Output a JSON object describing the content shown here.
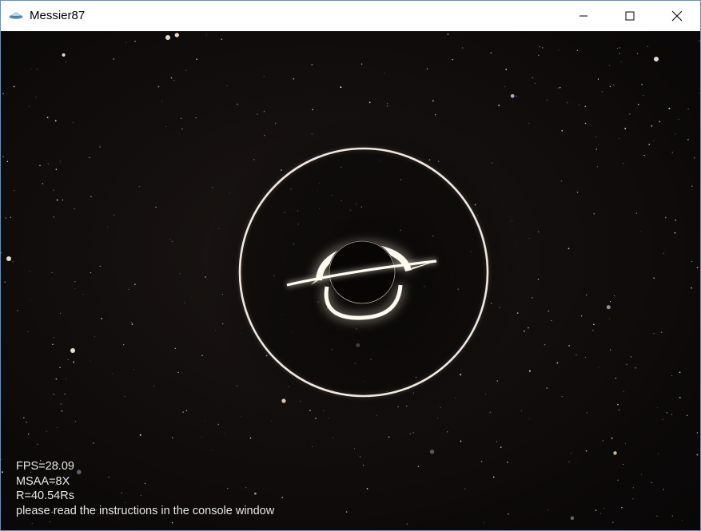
{
  "window": {
    "title": "Messier87",
    "app_icon": "ufo-icon",
    "controls": {
      "minimize_icon": "minimize-icon",
      "maximize_icon": "maximize-icon",
      "close_icon": "close-icon"
    }
  },
  "hud": {
    "fps": "FPS=28.09",
    "msaa": "MSAA=8X",
    "radius": "R=40.54Rs",
    "instructions": "please read the instructions in the console window"
  },
  "colors": {
    "space_background": "#0b0908",
    "photon_ring": "#f2e6dc",
    "accretion_glow": "#fff6e6",
    "hud_text": "#e6e6e6",
    "window_border": "#6e8fb5"
  }
}
